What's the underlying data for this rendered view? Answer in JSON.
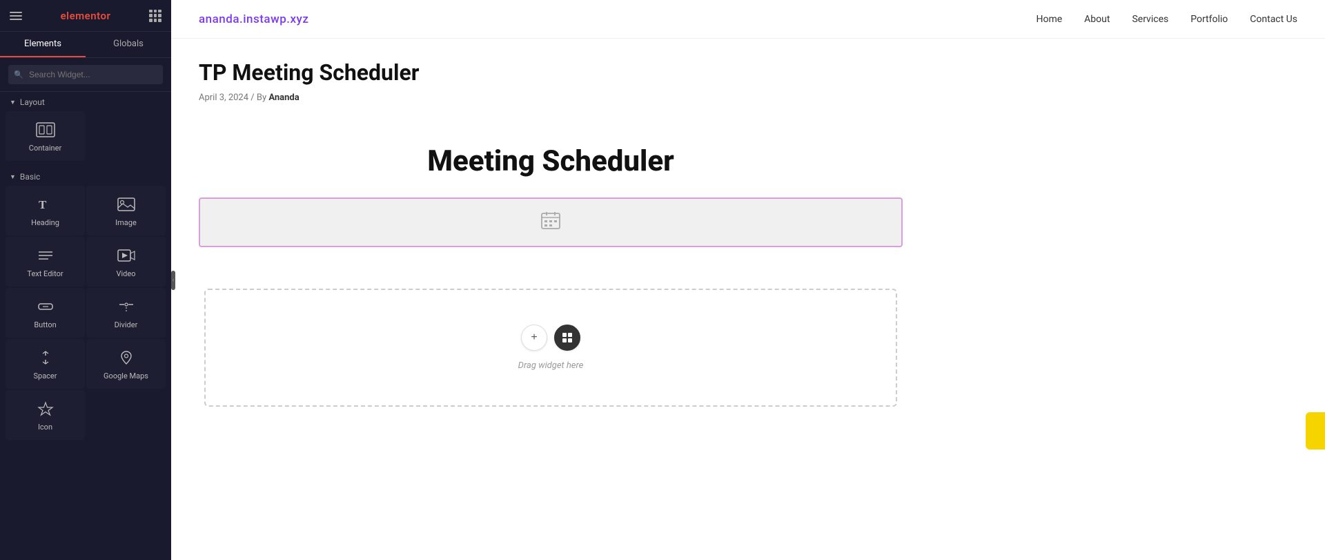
{
  "sidebar": {
    "logo": "elementor",
    "tabs": [
      {
        "id": "elements",
        "label": "Elements",
        "active": true
      },
      {
        "id": "globals",
        "label": "Globals",
        "active": false
      }
    ],
    "search": {
      "placeholder": "Search Widget..."
    },
    "sections": [
      {
        "id": "layout",
        "label": "Layout",
        "expanded": true,
        "widgets": [
          {
            "id": "container",
            "label": "Container",
            "icon": "container"
          }
        ]
      },
      {
        "id": "basic",
        "label": "Basic",
        "expanded": true,
        "widgets": [
          {
            "id": "heading",
            "label": "Heading",
            "icon": "heading"
          },
          {
            "id": "image",
            "label": "Image",
            "icon": "image"
          },
          {
            "id": "text-editor",
            "label": "Text Editor",
            "icon": "text-editor"
          },
          {
            "id": "video",
            "label": "Video",
            "icon": "video"
          },
          {
            "id": "button",
            "label": "Button",
            "icon": "button"
          },
          {
            "id": "divider",
            "label": "Divider",
            "icon": "divider"
          },
          {
            "id": "spacer",
            "label": "Spacer",
            "icon": "spacer"
          },
          {
            "id": "google-maps",
            "label": "Google Maps",
            "icon": "google-maps"
          },
          {
            "id": "icon",
            "label": "Icon",
            "icon": "icon"
          }
        ]
      }
    ]
  },
  "nav": {
    "logo": "ananda.instawp.xyz",
    "links": [
      {
        "id": "home",
        "label": "Home"
      },
      {
        "id": "about",
        "label": "About"
      },
      {
        "id": "services",
        "label": "Services"
      },
      {
        "id": "portfolio",
        "label": "Portfolio"
      },
      {
        "id": "contact-us",
        "label": "Contact Us"
      }
    ]
  },
  "page": {
    "post_title": "TP Meeting Scheduler",
    "post_meta": "April 3, 2024 / By Ananda",
    "heading": "Meeting Scheduler",
    "calendar_placeholder_icon": "📅",
    "drop_zone_text": "Drag widget here",
    "add_btn_label": "+",
    "settings_btn_label": "⚙"
  }
}
